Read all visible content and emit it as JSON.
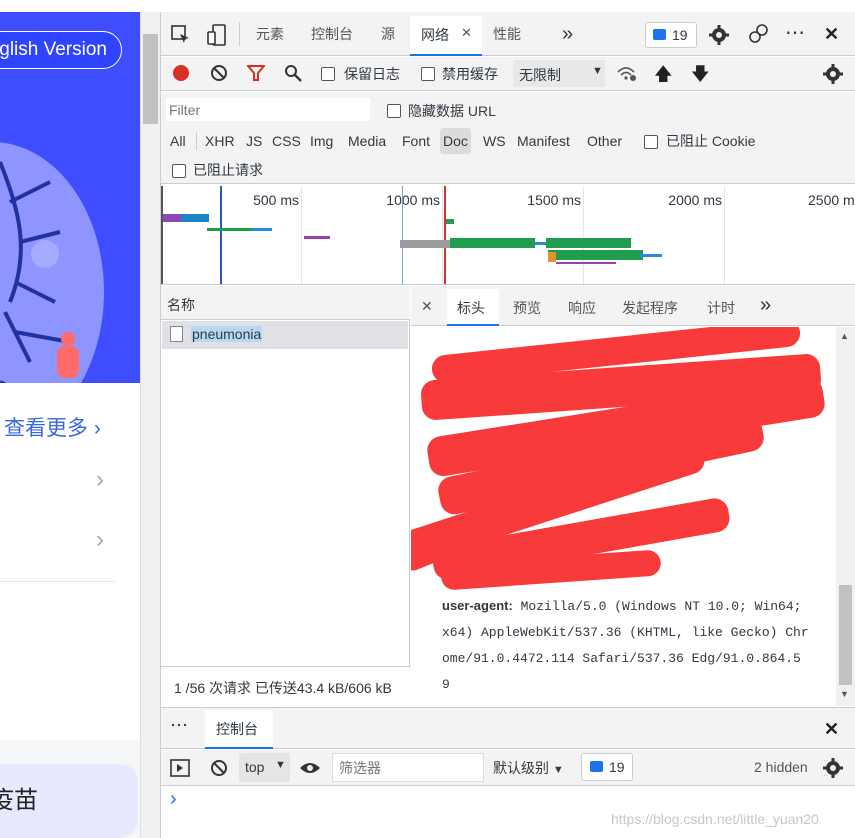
{
  "page": {
    "english_button": "glish Version",
    "view_more": "查看更多",
    "bottom_card": "疫苗"
  },
  "toolbar": {
    "tabs": [
      "元素",
      "控制台",
      "源",
      "网络",
      "性能"
    ],
    "active_tab": "网络",
    "more": "»",
    "issues_count": "19",
    "close": "✕",
    "preserve_log": "保留日志",
    "disable_cache": "禁用缓存",
    "throttle": "无限制"
  },
  "filter": {
    "placeholder": "Filter",
    "hide_data_url": "隐藏数据 URL",
    "types": [
      "All",
      "XHR",
      "JS",
      "CSS",
      "Img",
      "Media",
      "Font",
      "Doc",
      "WS",
      "Manifest",
      "Other"
    ],
    "active_type": "Doc",
    "blocked_cookies": "已阻止 Cookie",
    "blocked_requests": "已阻止请求"
  },
  "timeline": {
    "ticks": [
      "500 ms",
      "1000 ms",
      "1500 ms",
      "2000 ms",
      "2500 m"
    ]
  },
  "requests": {
    "header": "名称",
    "items": [
      "pneumonia"
    ],
    "summary": "1 /56 次请求  已传送43.4 kB/606 kB"
  },
  "detail": {
    "tabs": [
      "标头",
      "预览",
      "响应",
      "发起程序",
      "计时"
    ],
    "active_tab": "标头",
    "more": "»",
    "ua_key": "user-agent:",
    "ua_lines": [
      "Mozilla/5.0 (Windows NT 10.0; Win64;",
      "x64) AppleWebKit/537.36 (KHTML, like Gecko) Chr",
      "ome/91.0.4472.114 Safari/537.36 Edg/91.0.864.5",
      "9"
    ]
  },
  "drawer": {
    "dots": "⋯",
    "tab": "控制台",
    "context": "top",
    "filter_placeholder": "筛选器",
    "level": "默认级别",
    "issues_count": "19",
    "hidden": "2 hidden",
    "prompt": "›"
  },
  "watermark": "https://blog.csdn.net/little_yuan20"
}
